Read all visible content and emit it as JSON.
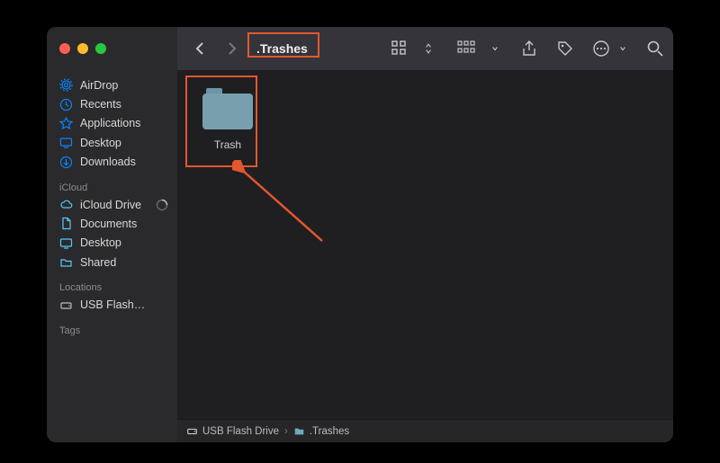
{
  "window": {
    "title": ".Trashes"
  },
  "sidebar": {
    "favorites": [
      {
        "icon": "airdrop",
        "label": "AirDrop",
        "color": "#0a84ff"
      },
      {
        "icon": "clock",
        "label": "Recents",
        "color": "#0a84ff"
      },
      {
        "icon": "apps",
        "label": "Applications",
        "color": "#0a84ff"
      },
      {
        "icon": "desktop",
        "label": "Desktop",
        "color": "#0a84ff"
      },
      {
        "icon": "download",
        "label": "Downloads",
        "color": "#0a84ff"
      }
    ],
    "icloud_heading": "iCloud",
    "icloud": [
      {
        "icon": "cloud",
        "label": "iCloud Drive",
        "showProgress": true,
        "color": "#5ac8fa"
      },
      {
        "icon": "doc",
        "label": "Documents",
        "color": "#5ac8fa"
      },
      {
        "icon": "desktop",
        "label": "Desktop",
        "color": "#5ac8fa"
      },
      {
        "icon": "sharedfolder",
        "label": "Shared",
        "color": "#5ac8fa"
      }
    ],
    "locations_heading": "Locations",
    "locations": [
      {
        "icon": "drive",
        "label": "USB Flash…",
        "color": "#bcbcbc"
      }
    ],
    "tags_heading": "Tags"
  },
  "content": {
    "items": [
      {
        "type": "folder",
        "label": "Trash"
      }
    ]
  },
  "pathbar": {
    "segments": [
      {
        "icon": "drive",
        "label": "USB Flash Drive"
      },
      {
        "icon": "folder",
        "label": ".Trashes"
      }
    ],
    "sep": "›"
  }
}
